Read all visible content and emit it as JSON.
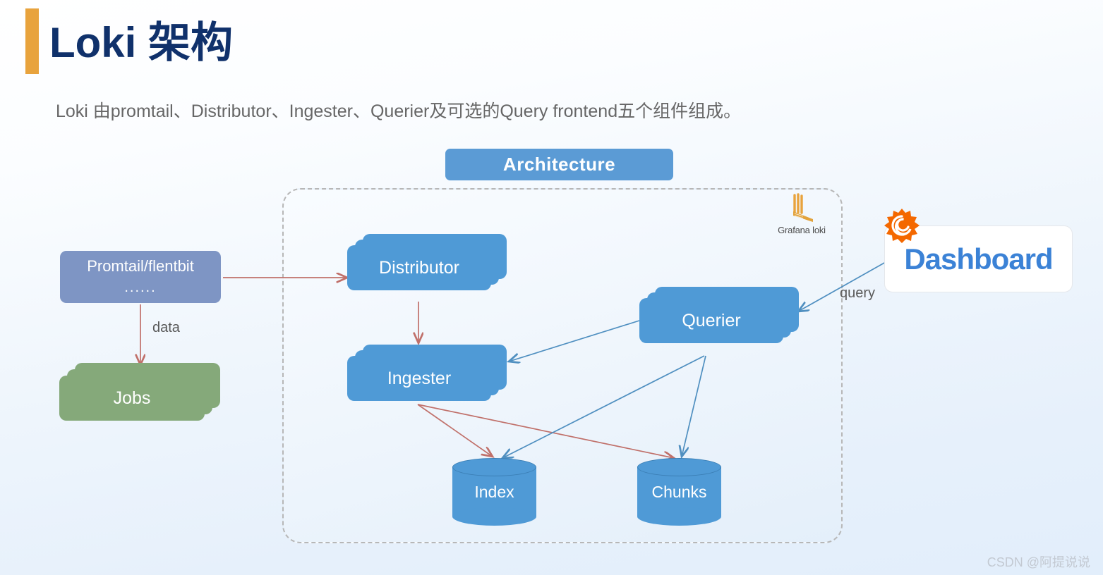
{
  "header": {
    "title": "Loki 架构",
    "subtitle": "Loki 由promtail、Distributor、Ingester、Querier及可选的Query frontend五个组件组成。",
    "accent_bar_color": "#e8a33d",
    "title_color": "#10316b"
  },
  "diagram": {
    "badge_label": "Architecture",
    "badge_color": "#5b9bd5",
    "panel_border": "dashed #b7b7b7",
    "nodes": {
      "promtail": {
        "label": "Promtail/flentbit",
        "sublabel": "......",
        "color": "#7e95c4"
      },
      "jobs": {
        "label": "Jobs",
        "color": "#85a97a"
      },
      "distributor": {
        "label": "Distributor",
        "color": "#4f9ad6"
      },
      "ingester": {
        "label": "Ingester",
        "color": "#4f9ad6"
      },
      "querier": {
        "label": "Querier",
        "color": "#4f9ad6"
      },
      "index": {
        "label": "Index",
        "color": "#4f9ad6"
      },
      "chunks": {
        "label": "Chunks",
        "color": "#4f9ad6"
      }
    },
    "edge_labels": {
      "data": "data",
      "query": "query"
    },
    "edge_colors": {
      "write_path": "#c0706a",
      "read_path": "#4f8fc0"
    },
    "loki_logo_text": "Grafana loki",
    "dashboard_label": "Dashboard",
    "dashboard_text_color": "#3b82d6",
    "grafana_orange": "#f46800"
  },
  "watermark": "CSDN @阿提说说"
}
